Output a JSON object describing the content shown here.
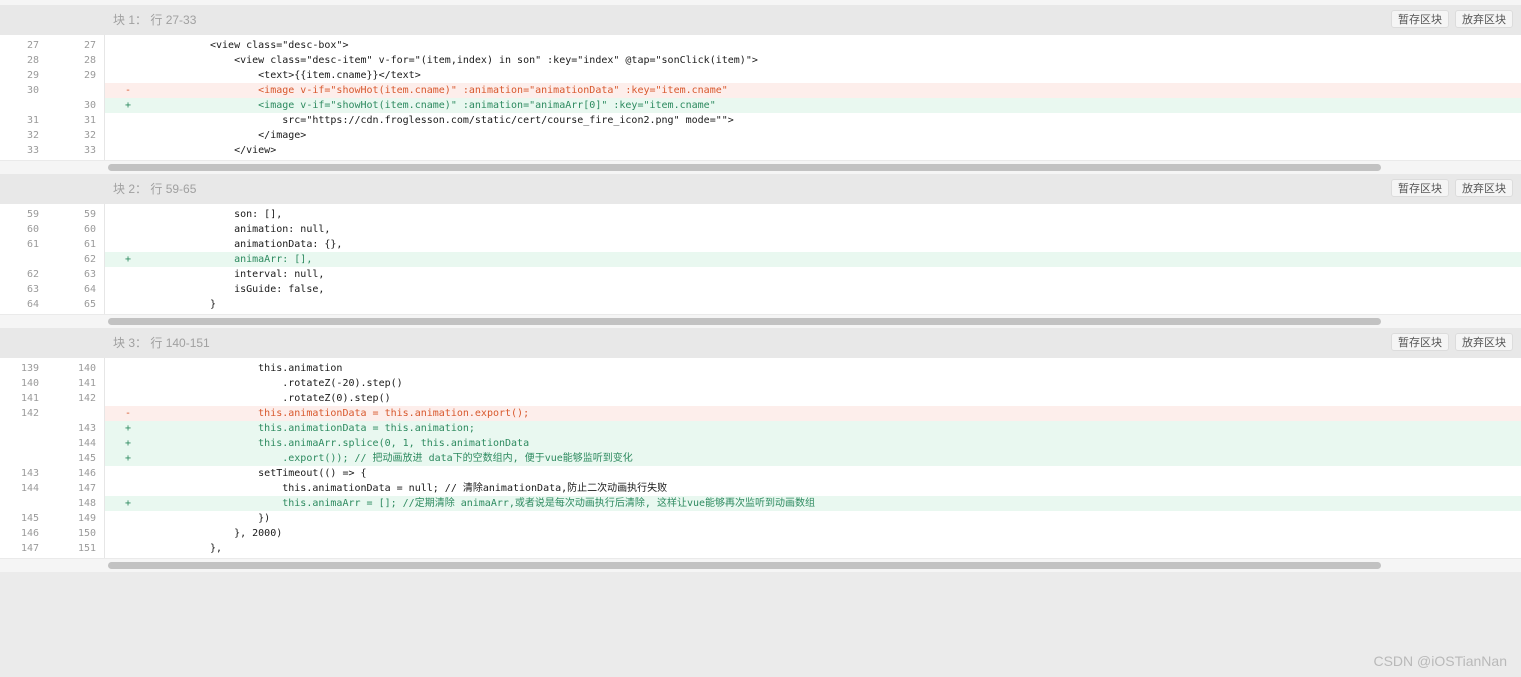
{
  "hunks": [
    {
      "label": "块 1：",
      "range": "行 27-33",
      "stash_label": "暂存区块",
      "discard_label": "放弃区块",
      "lines": [
        {
          "type": "ctx",
          "old": "27",
          "new": "27",
          "mark": "",
          "code": "<view class=\"desc-box\">"
        },
        {
          "type": "ctx",
          "old": "28",
          "new": "28",
          "mark": "",
          "code": "    <view class=\"desc-item\" v-for=\"(item,index) in son\" :key=\"index\" @tap=\"sonClick(item)\">"
        },
        {
          "type": "ctx",
          "old": "29",
          "new": "29",
          "mark": "",
          "code": "        <text>{{item.cname}}</text>"
        },
        {
          "type": "del",
          "old": "30",
          "new": "",
          "mark": "-",
          "code": "        <image v-if=\"showHot(item.cname)\" :animation=\"animationData\" :key=\"item.cname\""
        },
        {
          "type": "add",
          "old": "",
          "new": "30",
          "mark": "+",
          "code": "        <image v-if=\"showHot(item.cname)\" :animation=\"animaArr[0]\" :key=\"item.cname\""
        },
        {
          "type": "ctx",
          "old": "31",
          "new": "31",
          "mark": "",
          "code": "            src=\"https://cdn.froglesson.com/static/cert/course_fire_icon2.png\" mode=\"\">"
        },
        {
          "type": "ctx",
          "old": "32",
          "new": "32",
          "mark": "",
          "code": "        </image>"
        },
        {
          "type": "ctx",
          "old": "33",
          "new": "33",
          "mark": "",
          "code": "    </view>"
        }
      ]
    },
    {
      "label": "块 2：",
      "range": "行 59-65",
      "stash_label": "暂存区块",
      "discard_label": "放弃区块",
      "lines": [
        {
          "type": "ctx",
          "old": "59",
          "new": "59",
          "mark": "",
          "code": "    son: [],"
        },
        {
          "type": "ctx",
          "old": "60",
          "new": "60",
          "mark": "",
          "code": "    animation: null,"
        },
        {
          "type": "ctx",
          "old": "61",
          "new": "61",
          "mark": "",
          "code": "    animationData: {},"
        },
        {
          "type": "add",
          "old": "",
          "new": "62",
          "mark": "+",
          "code": "    animaArr: [],"
        },
        {
          "type": "ctx",
          "old": "62",
          "new": "63",
          "mark": "",
          "code": "    interval: null,"
        },
        {
          "type": "ctx",
          "old": "63",
          "new": "64",
          "mark": "",
          "code": "    isGuide: false,"
        },
        {
          "type": "ctx",
          "old": "64",
          "new": "65",
          "mark": "",
          "code": "}"
        }
      ]
    },
    {
      "label": "块 3：",
      "range": "行 140-151",
      "stash_label": "暂存区块",
      "discard_label": "放弃区块",
      "lines": [
        {
          "type": "ctx",
          "old": "139",
          "new": "140",
          "mark": "",
          "code": "        this.animation"
        },
        {
          "type": "ctx",
          "old": "140",
          "new": "141",
          "mark": "",
          "code": "            .rotateZ(-20).step()"
        },
        {
          "type": "ctx",
          "old": "141",
          "new": "142",
          "mark": "",
          "code": "            .rotateZ(0).step()"
        },
        {
          "type": "del",
          "old": "142",
          "new": "",
          "mark": "-",
          "code": "        this.animationData = this.animation.export();"
        },
        {
          "type": "add",
          "old": "",
          "new": "143",
          "mark": "+",
          "code": "        this.animationData = this.animation;"
        },
        {
          "type": "add",
          "old": "",
          "new": "144",
          "mark": "+",
          "code": "        this.animaArr.splice(0, 1, this.animationData"
        },
        {
          "type": "add",
          "old": "",
          "new": "145",
          "mark": "+",
          "code": "            .export()); // 把动画放进 data下的空数组内, 便于vue能够监听到变化"
        },
        {
          "type": "ctx",
          "old": "143",
          "new": "146",
          "mark": "",
          "code": "        setTimeout(() => {"
        },
        {
          "type": "ctx",
          "old": "144",
          "new": "147",
          "mark": "",
          "code": "            this.animationData = null; // 清除animationData,防止二次动画执行失败"
        },
        {
          "type": "add",
          "old": "",
          "new": "148",
          "mark": "+",
          "code": "            this.animaArr = []; //定期清除 animaArr,或者说是每次动画执行后清除, 这样让vue能够再次监听到动画数组"
        },
        {
          "type": "ctx",
          "old": "145",
          "new": "149",
          "mark": "",
          "code": "        })"
        },
        {
          "type": "ctx",
          "old": "146",
          "new": "150",
          "mark": "",
          "code": "    }, 2000)"
        },
        {
          "type": "ctx",
          "old": "147",
          "new": "151",
          "mark": "",
          "code": "},"
        }
      ]
    }
  ],
  "watermark": "CSDN @iOSTianNan"
}
